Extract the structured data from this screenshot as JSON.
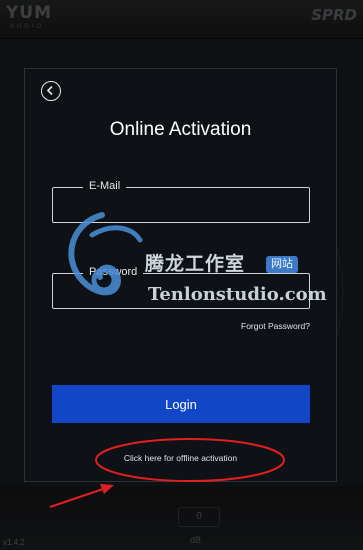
{
  "background": {
    "brand": "YUM",
    "brand_sub": "AUDIO",
    "product": "SPRD",
    "version": "v1.4.2",
    "field_value": "0",
    "unit": "dB"
  },
  "dialog": {
    "title": "Online Activation",
    "email_label": "E-Mail",
    "email_value": "",
    "password_label": "Password",
    "password_value": "",
    "forgot_password": "Forgot Password?",
    "login_label": "Login",
    "offline_link": "Click here for offline activation"
  },
  "watermark": {
    "chinese_text": "腾龙工作室",
    "badge": "网站",
    "english_text": "Tenlonstudio.com"
  },
  "colors": {
    "dialog_bg": "#0e1116",
    "login_button": "#1147c7",
    "annotation_red": "#e02020"
  },
  "icons": {
    "back": "back-arrow-icon"
  }
}
